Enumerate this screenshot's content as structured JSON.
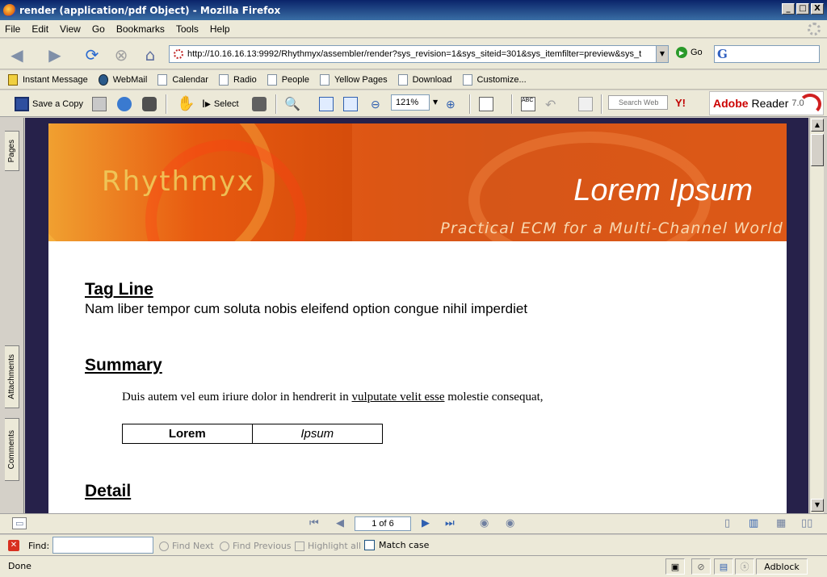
{
  "window": {
    "title": "render (application/pdf Object) - Mozilla Firefox",
    "minimize": "_",
    "maximize": "□",
    "close": "X"
  },
  "menu": [
    "File",
    "Edit",
    "View",
    "Go",
    "Bookmarks",
    "Tools",
    "Help"
  ],
  "nav": {
    "url": "http://10.16.16.13:9992/Rhythmyx/assembler/render?sys_revision=1&sys_siteid=301&sys_itemfilter=preview&sys_t",
    "go_label": "Go",
    "search_logo": "G"
  },
  "bookmarks": [
    "Instant Message",
    "WebMail",
    "Calendar",
    "Radio",
    "People",
    "Yellow Pages",
    "Download",
    "Customize..."
  ],
  "adobe_toolbar": {
    "save_copy": "Save a Copy",
    "select": "Select",
    "zoom": "121%",
    "search_placeholder": "Search Web",
    "yahoo": "Y!",
    "product": "Adobe",
    "product2": "Reader",
    "version": "7.0"
  },
  "left_tabs": [
    "Pages",
    "Attachments",
    "Comments"
  ],
  "document": {
    "banner": {
      "brand": "Rhythmyx",
      "title": "Lorem Ipsum",
      "tagline": "Practical ECM for a Multi-Channel World"
    },
    "tag_line_heading": "Tag Line",
    "tag_line_text": "Nam liber tempor cum soluta nobis eleifend option congue nihil imperdiet",
    "summary_heading": "Summary",
    "summary_text_before": "Duis autem vel eum iriure dolor in hendrerit in ",
    "summary_link": "vulputate velit esse",
    "summary_text_after": " molestie consequat,",
    "table": [
      "Lorem",
      "Ipsum"
    ],
    "detail_heading": "Detail"
  },
  "viewer": {
    "page_indicator": "1 of 6"
  },
  "findbar": {
    "label": "Find:",
    "find_next": "Find Next",
    "find_previous": "Find Previous",
    "highlight_all": "Highlight all",
    "match_case": "Match case"
  },
  "status": {
    "text": "Done",
    "adblock": "Adblock"
  }
}
